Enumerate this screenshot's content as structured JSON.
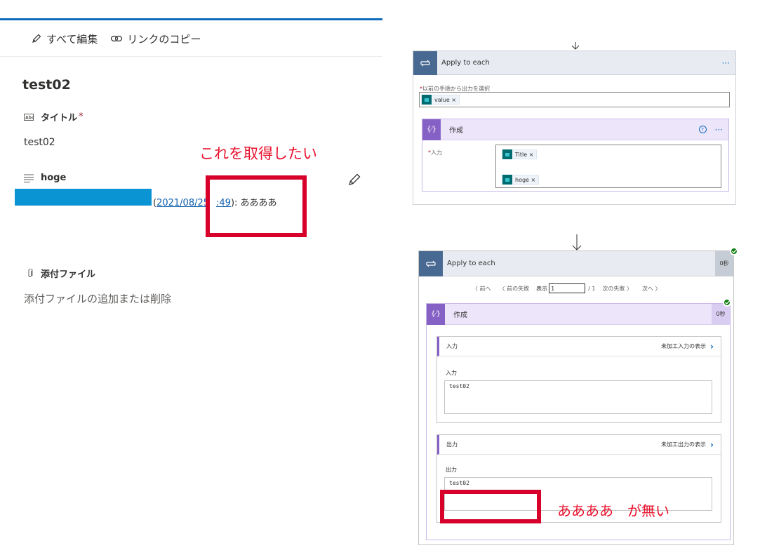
{
  "left": {
    "commands": {
      "edit_all": "すべて編集",
      "copy_link": "リンクのコピー"
    },
    "item_title": "test02",
    "title_field": {
      "label": "タイトル",
      "required_mark": "*",
      "value": "test02"
    },
    "hoge_field": {
      "label": "hoge",
      "history_open": "(",
      "history_date_link": "2021/08/25",
      "history_time_link": ":49",
      "history_suffix": "): ああああ"
    },
    "attachments": {
      "label": "添付ファイル",
      "value": "添付ファイルの追加または削除"
    },
    "annotation": "これを取得したい"
  },
  "flow_design": {
    "apply_to_each": {
      "title": "Apply to each",
      "more": "···"
    },
    "select_output_label": "以前の手順から出力を選択",
    "required_mark": "*",
    "value_token": "value ×",
    "compose": {
      "title": "作成",
      "help": "?",
      "more": "···"
    },
    "input_label": "入力",
    "title_token": "Title ×",
    "hoge_token": "hoge ×"
  },
  "flow_run": {
    "apply_to_each": {
      "title": "Apply to each",
      "duration": "0秒"
    },
    "pager": {
      "prev": "〈 前へ",
      "prev_fail": "〈 前の失敗",
      "show_label": "表示",
      "page_value": "1",
      "page_total": "/ 1",
      "next_fail": "次の失敗 〉",
      "next": "次へ 〉"
    },
    "compose": {
      "title": "作成",
      "duration": "0秒"
    },
    "inputs": {
      "header": "入力",
      "raw_link": "未加工入力の表示",
      "label": "入力",
      "value": "test02"
    },
    "outputs": {
      "header": "出力",
      "raw_link": "未加工出力の表示",
      "label": "出力",
      "value": "test02"
    },
    "annotation": "ああああ　が無い"
  },
  "colors": {
    "accent": "#0f6cbd",
    "annotation_red": "#e8112d",
    "loop": "#486991",
    "compose": "#8661c5",
    "success": "#107c10"
  }
}
